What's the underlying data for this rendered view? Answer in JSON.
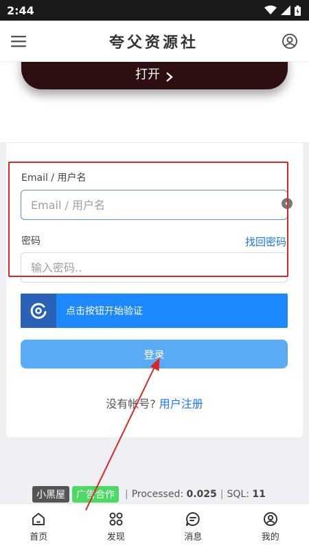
{
  "status": {
    "time": "2:44"
  },
  "appbar": {
    "title": "夸父资源社"
  },
  "open_card": {
    "button_label": "打开"
  },
  "login": {
    "email_label": "Email / 用户名",
    "email_placeholder": "Email / 用户名",
    "password_label": "密码",
    "forgot_link": "找回密码",
    "password_placeholder": "输入密码..",
    "captcha_text": "点击按钮开始验证",
    "login_button": "登录",
    "no_account_text": "没有帐号?",
    "register_link": "用户注册"
  },
  "footer": {
    "tag_dark": "小黑屋",
    "tag_ad": "广告合作",
    "processed_label": "Processed:",
    "processed_value": "0.025",
    "sql_label": "SQL:",
    "sql_value": "11"
  },
  "nav": {
    "items": [
      {
        "label": "首页",
        "icon": "home-icon"
      },
      {
        "label": "发现",
        "icon": "grid-icon"
      },
      {
        "label": "消息",
        "icon": "chat-icon"
      },
      {
        "label": "我的",
        "icon": "user-icon"
      }
    ]
  },
  "colors": {
    "accent": "#1677ff",
    "login_button": "#5aaaf6",
    "captcha": "#1e88ff",
    "highlight": "#e02424"
  }
}
